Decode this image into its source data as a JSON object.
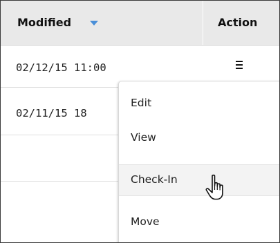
{
  "table": {
    "headers": {
      "modified": "Modified",
      "action": "Action"
    },
    "sort_indicator": "sort-descending-icon",
    "rows": [
      {
        "modified": "02/12/15 11:00",
        "action_icon": "hamburger-menu-icon"
      },
      {
        "modified": "02/11/15 18"
      },
      {
        "modified": ""
      }
    ]
  },
  "action_menu": {
    "items": [
      {
        "label": "Edit"
      },
      {
        "label": "View"
      },
      {
        "label": "Check-In",
        "hovered": true
      },
      {
        "label": "Move"
      }
    ]
  },
  "cursor": "hand-pointer-icon",
  "colors": {
    "header_bg": "#e9e9e9",
    "sort_arrow": "#4a8fd8",
    "hover_bg": "#f3f3f3",
    "border": "#3a3a3a"
  }
}
